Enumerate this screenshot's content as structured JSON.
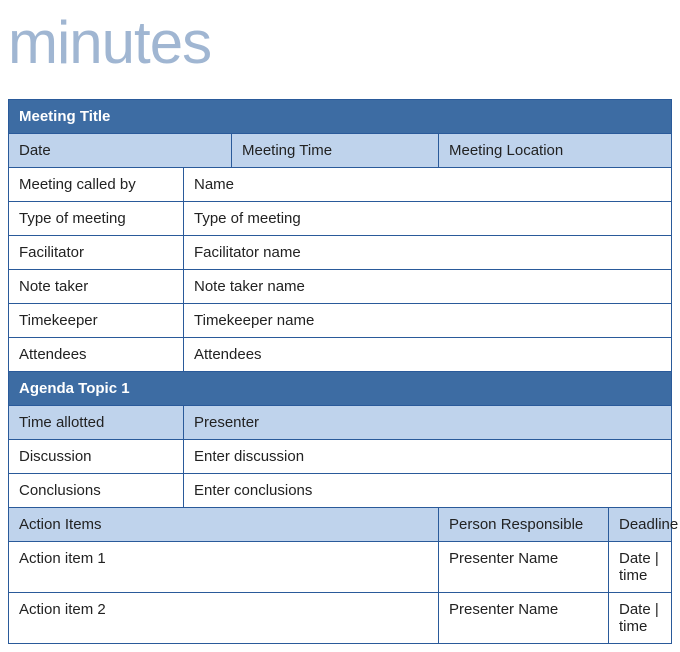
{
  "page_title": "minutes",
  "meeting": {
    "title_header": "Meeting Title",
    "date_label": "Date",
    "time_label": "Meeting Time",
    "location_label": "Meeting Location",
    "rows": [
      {
        "label": "Meeting called by",
        "value": "Name"
      },
      {
        "label": "Type of meeting",
        "value": "Type of meeting"
      },
      {
        "label": "Facilitator",
        "value": "Facilitator name"
      },
      {
        "label": "Note taker",
        "value": "Note taker name"
      },
      {
        "label": "Timekeeper",
        "value": "Timekeeper name"
      },
      {
        "label": "Attendees",
        "value": "Attendees"
      }
    ]
  },
  "agenda": {
    "header": "Agenda Topic 1",
    "time_allotted_label": "Time allotted",
    "presenter_label": "Presenter",
    "discussion_label": "Discussion",
    "discussion_value": "Enter discussion",
    "conclusions_label": "Conclusions",
    "conclusions_value": "Enter conclusions"
  },
  "actions": {
    "header_items": "Action Items",
    "header_person": "Person Responsible",
    "header_deadline": "Deadline",
    "rows": [
      {
        "item": "Action item 1",
        "person": "Presenter Name",
        "deadline": "Date | time"
      },
      {
        "item": "Action item 2",
        "person": "Presenter Name",
        "deadline": "Date | time"
      }
    ]
  }
}
